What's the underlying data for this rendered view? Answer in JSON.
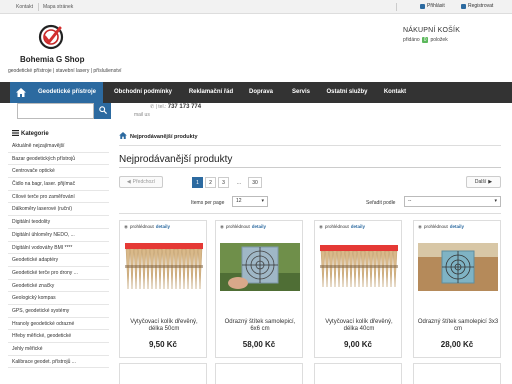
{
  "topbar": {
    "links": [
      "Kontakt",
      "Mapa stránek"
    ],
    "login": "Přihlásit",
    "register": "Registrovat"
  },
  "header": {
    "shop_name": "Bohemia G Shop",
    "tagline": "geodetické přístroje | stavební lasery | příslušenství",
    "cart_title": "NÁKUPNÍ KOŠÍK",
    "cart_prefix": "přidáno",
    "cart_count": "0",
    "cart_suffix": "položek"
  },
  "nav": {
    "items": [
      "Geodetické přístroje",
      "Obchodní podmínky",
      "Reklamační řád",
      "Doprava",
      "Servis",
      "Ostatní služby",
      "Kontakt"
    ]
  },
  "contact": {
    "phone_label": "| tel.:",
    "phone": "737 173 774",
    "mail_label": "mail us"
  },
  "search": {
    "placeholder": ""
  },
  "sidebar": {
    "title": "Kategorie",
    "items": [
      "Aktuálně nejzajímavější",
      "Bazar geodetických přístrojů",
      "Centrovače optické",
      "Čidlo na bagr, laser. přijímač",
      "Cílové terče pro zaměřování",
      "Dálkoměry laserové (ruční)",
      "Digitální teodolity",
      "Digitální úhloměry NEDO, ...",
      "Digitální vodováhy BMI ****",
      "Geodetické adaptéry",
      "Geodetické terče pro drony ...",
      "Geodetické značky",
      "Geologický kompas",
      "GPS, geodetické systémy",
      "Hranoly geodetické odrazné",
      "Hřeby měřické, geodetické",
      "Jehly měřické",
      "Kalibrace geodet. přístrojů ..."
    ]
  },
  "breadcrumb": {
    "current": "Nejprodávanější produkty"
  },
  "page": {
    "title": "Nejprodávanější produkty"
  },
  "pagination": {
    "prev": "Předchozí",
    "next": "Další",
    "pages": [
      "1",
      "2",
      "3",
      "...",
      "30"
    ],
    "active": "1"
  },
  "listing": {
    "items_per_page_label": "Items per page",
    "items_per_page": "12",
    "sort_label": "Seřadit podle",
    "sort_value": "--"
  },
  "products": [
    {
      "quick": "prohlédnout",
      "detail": "detaily",
      "name": "Vytyčovací kolík dřevěný, délka 50cm",
      "price": "9,50 Kč"
    },
    {
      "quick": "prohlédnout",
      "detail": "detaily",
      "name": "Odrazný štítek samolepicí, 6x6 cm",
      "price": "58,00 Kč"
    },
    {
      "quick": "prohlédnout",
      "detail": "detaily",
      "name": "Vytyčovací kolík dřevěný, délka 40cm",
      "price": "9,00 Kč"
    },
    {
      "quick": "prohlédnout",
      "detail": "detaily",
      "name": "Odrazný štítek samolepicí 3x3 cm",
      "price": "28,00 Kč"
    }
  ],
  "colors": {
    "accent": "#2c6aa0",
    "nav_bg": "#333333",
    "badge": "#5cb85c"
  }
}
